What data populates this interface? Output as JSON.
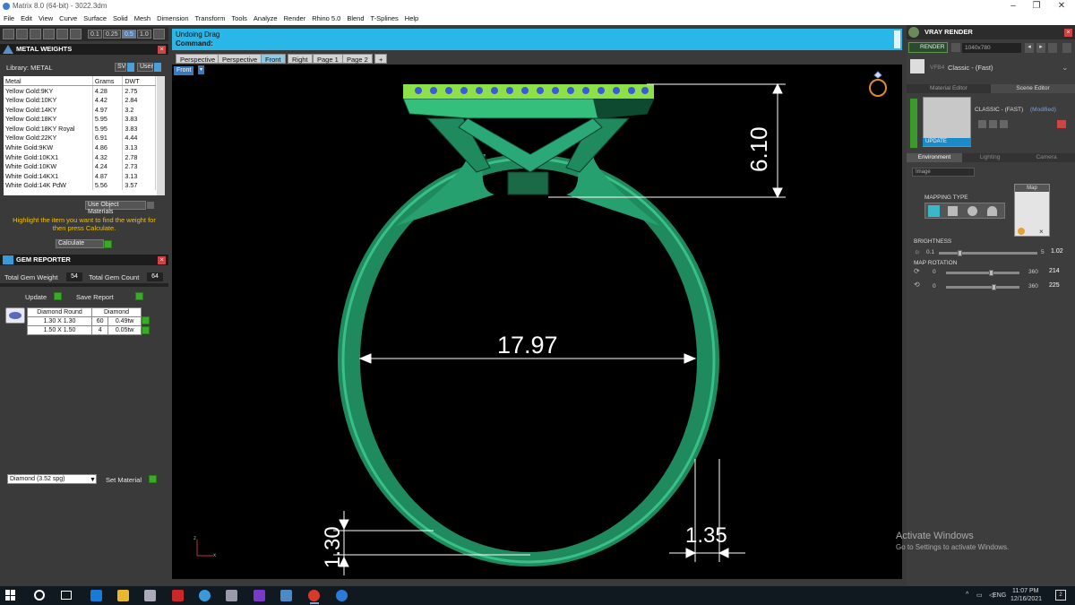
{
  "window": {
    "title": "Matrix 8.0 (64-bit) - 3022.3dm"
  },
  "menu": [
    "File",
    "Edit",
    "View",
    "Curve",
    "Surface",
    "Solid",
    "Mesh",
    "Dimension",
    "Transform",
    "Tools",
    "Analyze",
    "Render",
    "Rhino 5.0",
    "Blend",
    "T-Splines",
    "Help"
  ],
  "toolrow": {
    "v1": "0.1",
    "v2": "0.25",
    "v3": "0.5",
    "v4": "1.0"
  },
  "metal_weights": {
    "title": "METAL WEIGHTS",
    "library_label": "Library: METAL",
    "sv": "SV",
    "user": "User",
    "headers": [
      "Metal",
      "Grams",
      "DWT"
    ],
    "rows": [
      [
        "Yellow Gold:9KY",
        "4.28",
        "2.75"
      ],
      [
        "Yellow Gold:10KY",
        "4.42",
        "2.84"
      ],
      [
        "Yellow Gold:14KY",
        "4.97",
        "3.2"
      ],
      [
        "Yellow Gold:18KY",
        "5.95",
        "3.83"
      ],
      [
        "Yellow Gold:18KY Royal",
        "5.95",
        "3.83"
      ],
      [
        "Yellow Gold:22KY",
        "6.91",
        "4.44"
      ],
      [
        "White Gold:9KW",
        "4.86",
        "3.13"
      ],
      [
        "White Gold:10KX1",
        "4.32",
        "2.78"
      ],
      [
        "White Gold:10KW",
        "4.24",
        "2.73"
      ],
      [
        "White Gold:14KX1",
        "4.87",
        "3.13"
      ],
      [
        "White Gold:14K PdW",
        "5.56",
        "3.57"
      ]
    ],
    "use_object_materials": "Use Object Materials",
    "hint": "Highlight the item you want to find the weight for then press Calculate.",
    "calculate": "Calculate"
  },
  "gem_reporter": {
    "title": "GEM REPORTER",
    "total_weight_label": "Total Gem Weight",
    "total_weight": "54",
    "total_count_label": "Total Gem Count",
    "total_count": "64",
    "update": "Update",
    "save_report": "Save Report",
    "headers": [
      "Diamond Round",
      "Diamond"
    ],
    "rows": [
      [
        "1.30 X 1.30",
        "60",
        "0.49tw"
      ],
      [
        "1.50 X 1.50",
        "4",
        "0.05tw"
      ]
    ],
    "material_select": "Diamond    (3.52 spg)",
    "set_material": "Set Material"
  },
  "command": {
    "line1": "Undoing Drag",
    "line2": "Command:"
  },
  "tabs": [
    "Perspective",
    "Perspective",
    "Front",
    "Right",
    "Page 1",
    "Page 2",
    "+"
  ],
  "active_tab": 2,
  "viewport": {
    "label": "Front",
    "dims": {
      "top_height": "6.10",
      "inner_diameter": "17.97",
      "shank_thickness": "1.30",
      "shank_width": "1.35"
    },
    "axis": {
      "z": "z",
      "x": "x"
    }
  },
  "vray": {
    "title": "VRAY RENDER",
    "render": "RENDER",
    "resolution": "1040x780",
    "preset_tag": "VFB4",
    "preset": "Classic - (Fast)",
    "tab_material": "Material Editor",
    "tab_scene": "Scene Editor",
    "scene_name": "CLASSIC - (FAST)",
    "modified": "(Modified)",
    "update": "UPDATE",
    "env_tabs": [
      "Environment",
      "Lighting",
      "Camera"
    ],
    "image_select": "Image",
    "mapping_type": "MAPPING TYPE",
    "map_label": "Map",
    "brightness": {
      "label": "BRIGHTNESS",
      "min": "0.1",
      "max": "5",
      "value": "1.02",
      "level": 0.19
    },
    "map_rotation": {
      "label": "MAP ROTATION",
      "r1": {
        "min": "0",
        "max": "360",
        "value": "214",
        "level": 0.59
      },
      "r2": {
        "min": "0",
        "max": "360",
        "value": "225",
        "level": 0.62
      }
    }
  },
  "watermark": {
    "line1": "Activate Windows",
    "line2": "Go to Settings to activate Windows."
  },
  "taskbar": {
    "lang": "ENG",
    "time": "11:07 PM",
    "date": "12/16/2021",
    "notif": "2"
  }
}
